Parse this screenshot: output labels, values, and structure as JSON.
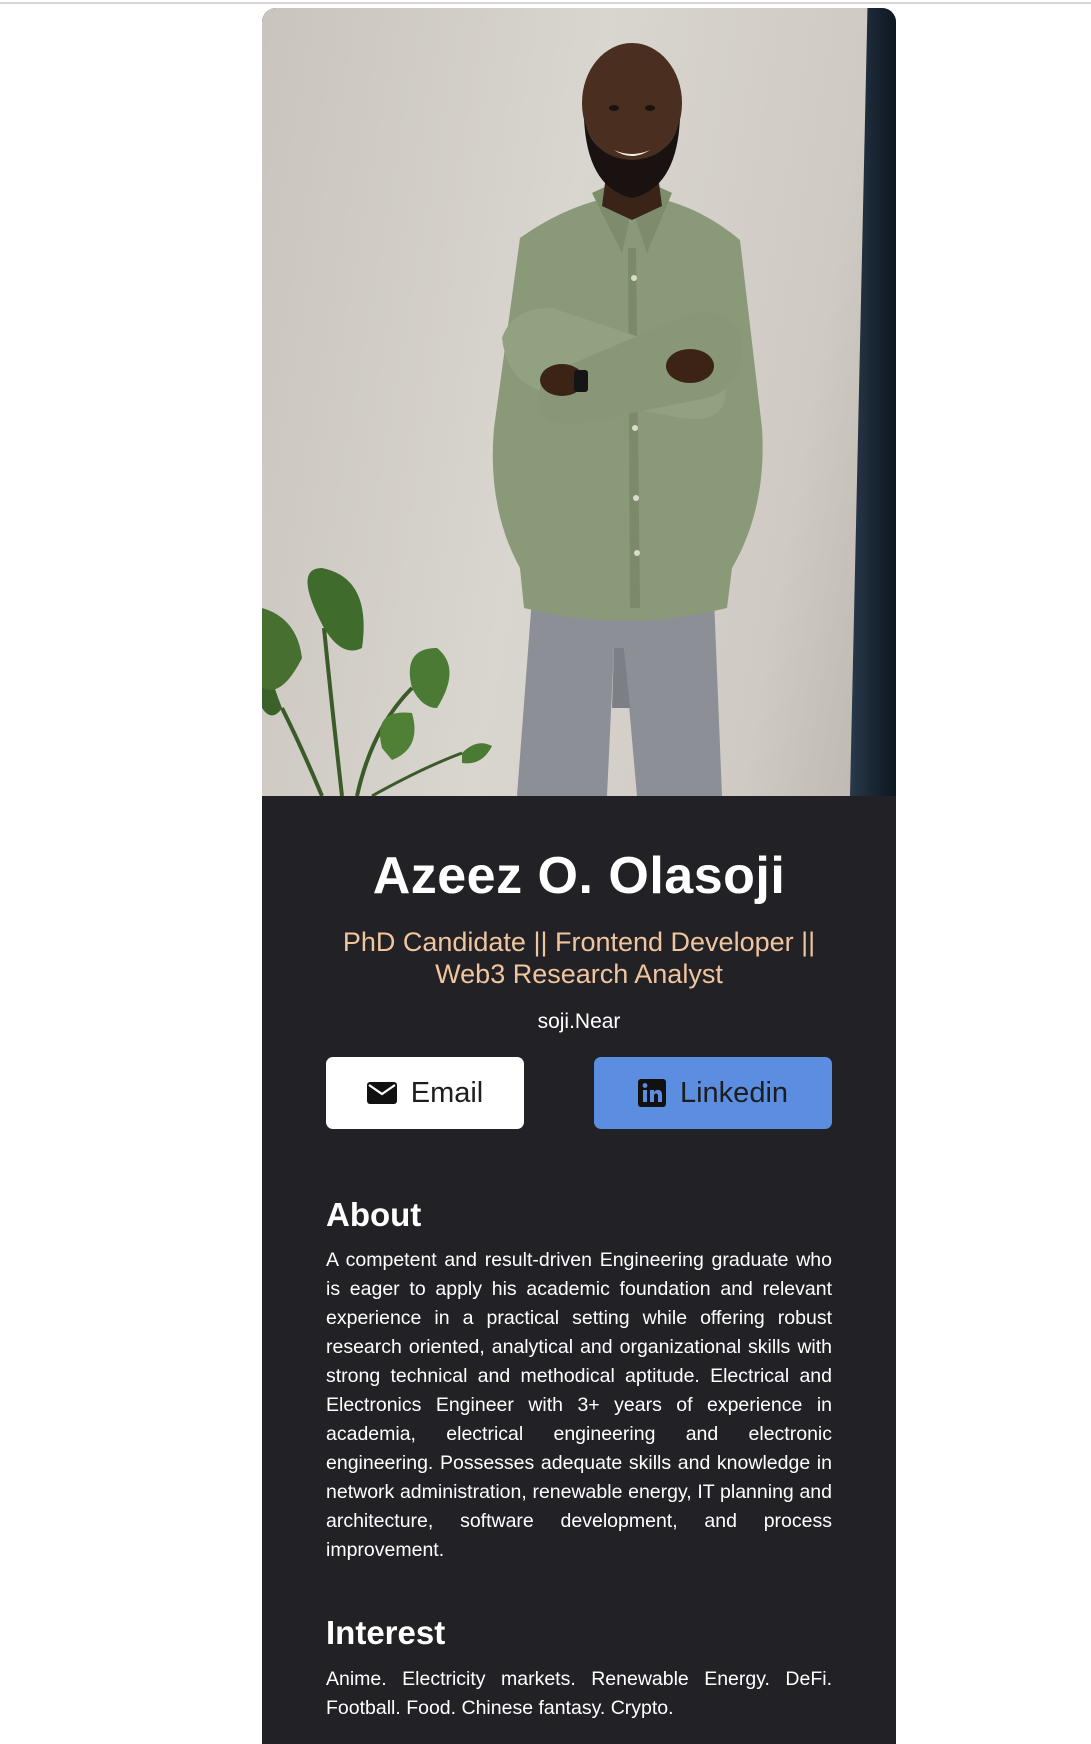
{
  "profile": {
    "photo_alt": "profile photo",
    "name": "Azeez O. Olasoji",
    "headline": "PhD Candidate || Frontend Developer || Web3 Research Analyst",
    "handle": "soji.Near"
  },
  "buttons": {
    "email_label": "Email",
    "email_icon": "envelope-icon",
    "linkedin_label": "Linkedin",
    "linkedin_icon": "linkedin-icon"
  },
  "about": {
    "title": "About",
    "body": "A competent and result-driven Engineering graduate who is eager to apply his academic foundation and relevant experience in a practical setting while offering robust research oriented, analytical and organizational skills with strong technical and methodical aptitude. Electrical and Electronics Engineer with 3+ years of experience in academia, electrical engineering and electronic engineering. Possesses adequate skills and knowledge in network administration, renewable energy, IT planning and architecture, software development, and process improvement."
  },
  "interest": {
    "title": "Interest",
    "body": "Anime. Electricity markets. Renewable Energy. DeFi. Football. Food. Chinese fantasy. Crypto."
  },
  "colors": {
    "card_background": "#222226",
    "headline_accent": "#f0c59e",
    "linkedin_button": "#5b8de0",
    "email_button": "#ffffff"
  }
}
